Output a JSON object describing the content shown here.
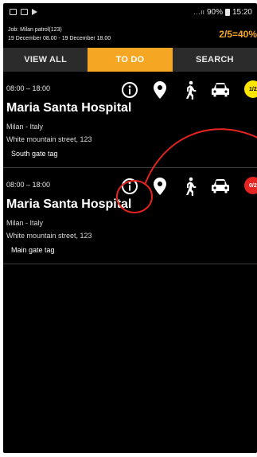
{
  "statusbar": {
    "signal": "…ıı",
    "battery_text": "90%",
    "time": "15:20"
  },
  "job": {
    "name_line": "Job: Milan patrol(123)",
    "range_line": "19 December 08.00 - 19 December 18.00",
    "progress": "2/5=40%"
  },
  "tabs": [
    {
      "label": "VIEW ALL"
    },
    {
      "label": "TO DO"
    },
    {
      "label": "SEARCH"
    }
  ],
  "active_tab_index": 1,
  "cards": [
    {
      "time": "08:00 – 18:00",
      "title": "Maria Santa Hospital",
      "location": "Milan - Italy",
      "address": "White mountain street, 123",
      "tag": "South gate tag",
      "badge": "1/2",
      "badge_color": "#ffe600",
      "badge_text_color": "#000000"
    },
    {
      "time": "08:00 – 18:00",
      "title": "Maria Santa Hospital",
      "location": "Milan - Italy",
      "address": "White mountain street, 123",
      "tag": "Main gate tag",
      "badge": "0/2",
      "badge_color": "#e52421",
      "badge_text_color": "#ffffff"
    }
  ],
  "colors": {
    "accent": "#f5a623",
    "annotation": "#e52421"
  },
  "icons": [
    "info-icon",
    "map-pin-icon",
    "walking-person-icon",
    "car-icon"
  ]
}
